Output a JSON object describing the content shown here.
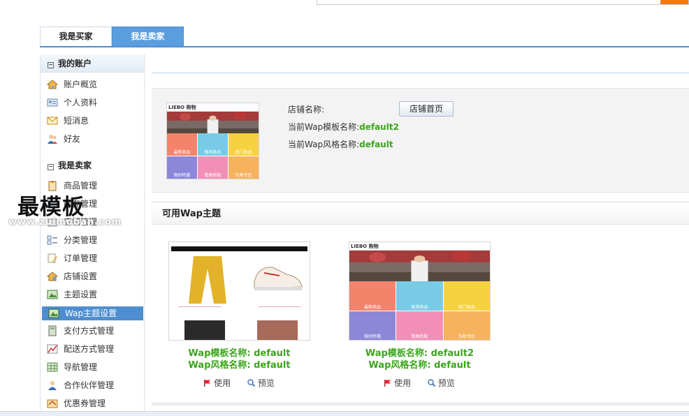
{
  "role_tabs": {
    "buyer": "我是买家",
    "seller": "我是卖家"
  },
  "sidebar": {
    "account_header": "我的账户",
    "account_items": [
      "账户概览",
      "个人资料",
      "短消息",
      "好友"
    ],
    "seller_header": "我是卖家",
    "seller_items": [
      "商品管理",
      "库存管理",
      "店铺管理",
      "分类管理",
      "订单管理",
      "店铺设置",
      "主题设置",
      "Wap主题设置",
      "支付方式管理",
      "配送方式管理",
      "导航管理",
      "合作伙伴管理",
      "优惠券管理"
    ],
    "active_item": "Wap主题设置"
  },
  "watermark": {
    "title": "最模板",
    "sub": "www.zuimoban.com"
  },
  "store_info": {
    "name_label": "店铺名称:",
    "home_button": "店铺首页",
    "template_label": "当前Wap模板名称:",
    "template_value": "default2",
    "style_label": "当前Wap风格名称:",
    "style_value": "default"
  },
  "themes_section": {
    "title": "可用Wap主题",
    "themes": [
      {
        "name_line": "Wap模板名称: default",
        "style_line": "Wap风格名称: default",
        "use": "使用",
        "preview": "预览"
      },
      {
        "name_line": "Wap模板名称: default2",
        "style_line": "Wap风格名称: default",
        "use": "使用",
        "preview": "预览"
      }
    ]
  },
  "mobile_preview": {
    "logo": "LIEBO 购物",
    "tiles": [
      "最新商品",
      "推荐商品",
      "热门商品",
      "限时特惠",
      "看图搭配",
      "包邮专区"
    ]
  },
  "colors": {
    "accent": "#4e8ed0",
    "green": "#3aa61a",
    "orange": "#f07a16"
  }
}
